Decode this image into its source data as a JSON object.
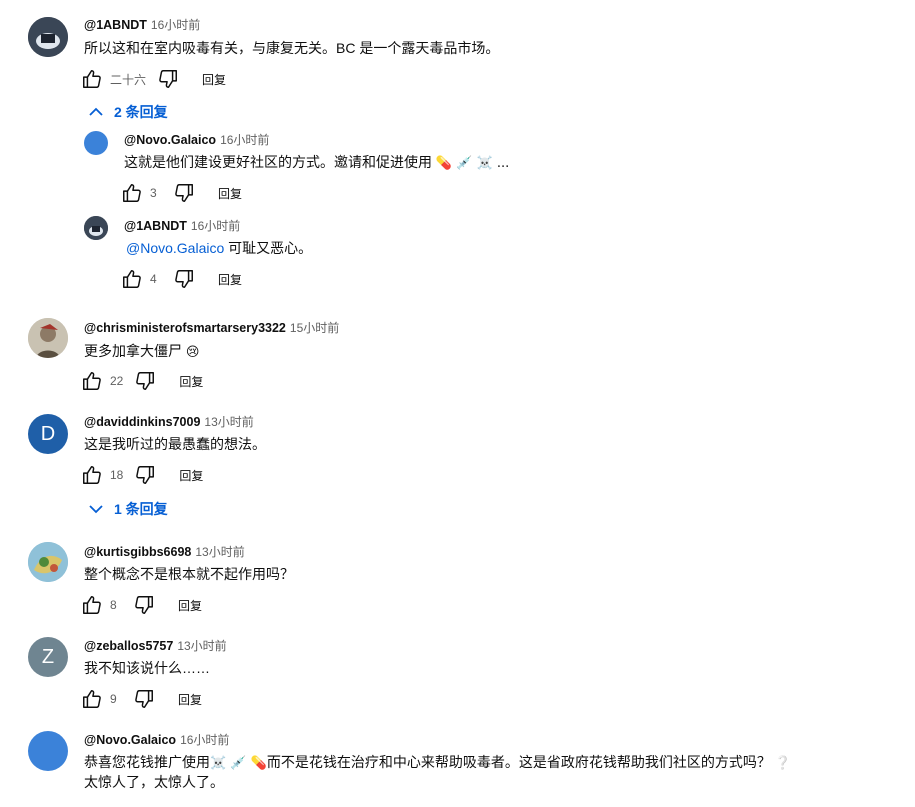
{
  "colors": {
    "link": "#065fd4",
    "muted": "#606060",
    "text": "#0f0f0f"
  },
  "comments": [
    {
      "author": "@1ABNDT",
      "time": "16小时前",
      "text": "所以这和在室内吸毒有关，与康复无关。BC 是一个露天毒品市场。",
      "likes": "二十六",
      "reply": "回复"
    },
    {
      "author": "@Novo.Galaico",
      "time": "16小时前",
      "text": "这就是他们建设更好社区的方式。邀请和促进使用",
      "emojis": "💊 💉 ☠️ ...",
      "likes": "3",
      "reply": "回复"
    },
    {
      "author": "@1ABNDT",
      "time": "16小时前",
      "mention": "@Novo.Galaico",
      "text": " 可耻又恶心。",
      "likes": "4",
      "reply": "回复"
    },
    {
      "author": "@chrisministerofsmartarsery3322",
      "time": "15小时前",
      "text": "更多加拿大僵尸",
      "emojis": "😢",
      "likes": "22",
      "reply": "回复"
    },
    {
      "author": "@daviddinkins7009",
      "time": "13小时前",
      "text": "这是我听过的最愚蠢的想法。",
      "likes": "18",
      "reply": "回复",
      "avatar_letter": "D"
    },
    {
      "author": "@kurtisgibbs6698",
      "time": "13小时前",
      "text": "整个概念不是根本就不起作用吗？",
      "likes": "8",
      "reply": "回复"
    },
    {
      "author": "@zeballos5757",
      "time": "13小时前",
      "text": "我不知该说什么……",
      "likes": "9",
      "reply": "回复",
      "avatar_letter": "Z"
    },
    {
      "author": "@Novo.Galaico",
      "time": "16小时前",
      "text_prefix": "恭喜您花钱推广使用",
      "emojis": "☠️ 💉 💊",
      "text": "而不是花钱在治疗和中心来帮助吸毒者。这是省政府花钱帮助我们社区的方式吗？",
      "emoji_end": "❔",
      "text_line2": "太惊人了，太惊人了。"
    }
  ],
  "toggles": [
    {
      "label": "2 条回复",
      "state": "expanded"
    },
    {
      "label": "1 条回复",
      "state": "collapsed"
    }
  ],
  "icons": {
    "like": "thumb-up-icon",
    "dislike": "thumb-down-icon",
    "expand": "chevron-up-icon",
    "collapse": "chevron-down-icon"
  }
}
